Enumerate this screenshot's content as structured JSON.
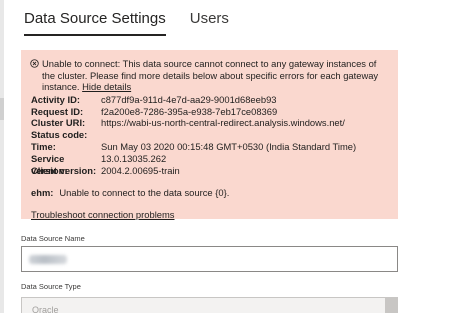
{
  "tabs": [
    {
      "label": "Data Source Settings",
      "active": true
    },
    {
      "label": "Users",
      "active": false
    }
  ],
  "error": {
    "icon": "error-circle-icon",
    "message": "Unable to connect: This data source cannot connect to any gateway instances of the cluster. Please find more details below about specific errors for each gateway instance.",
    "hide_details_link": "Hide details",
    "details": [
      {
        "key": "Activity ID:",
        "value": "c877df9a-911d-4e7d-aa29-9001d68eeb93"
      },
      {
        "key": "Request ID:",
        "value": "f2a200e8-7286-395a-e938-7eb17ce08369"
      },
      {
        "key": "Cluster URI:",
        "value": "https://wabi-us-north-central-redirect.analysis.windows.net/"
      },
      {
        "key": "Status code:",
        "value": ""
      },
      {
        "key": "Time:",
        "value": "Sun May 03 2020 00:15:48 GMT+0530 (India Standard Time)"
      },
      {
        "key": "Service version:",
        "value": "13.0.13035.262"
      },
      {
        "key": "Client version:",
        "value": "2004.2.00695-train"
      }
    ],
    "ehm_key": "ehm:",
    "ehm_value": "Unable to connect to the data source {0}.",
    "troubleshoot_link": "Troubleshoot connection problems",
    "background": "#fad8cf"
  },
  "data_source_name": {
    "label": "Data Source Name",
    "value": ""
  },
  "data_source_type": {
    "label": "Data Source Type",
    "value": "Oracle"
  }
}
